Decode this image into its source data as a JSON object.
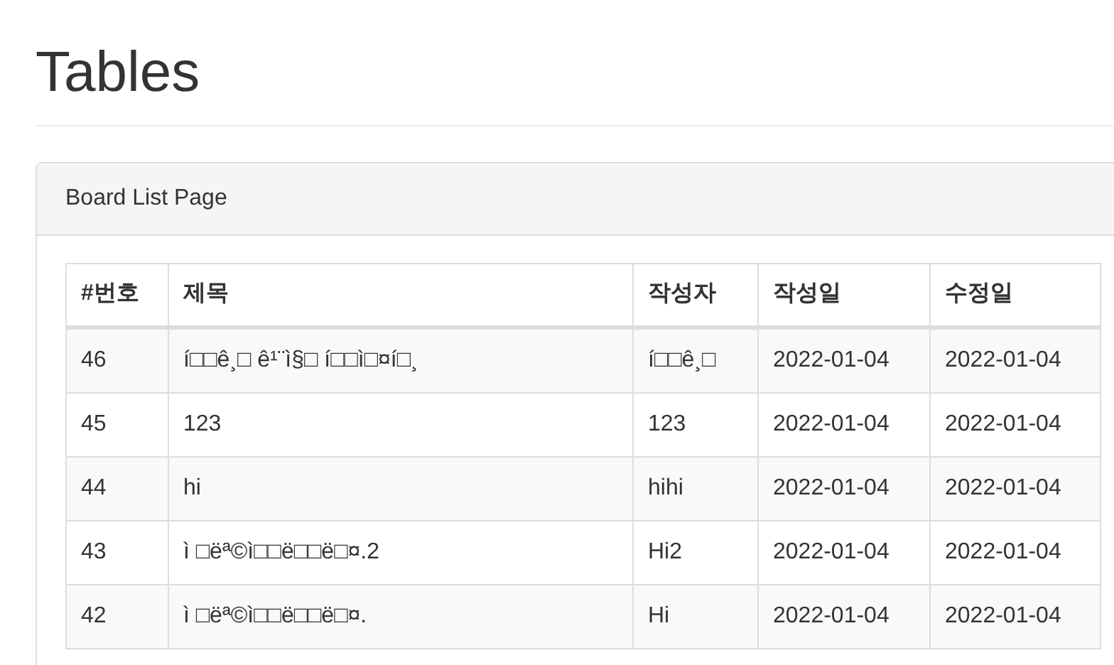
{
  "page_title": "Tables",
  "panel": {
    "heading": "Board List Page"
  },
  "table": {
    "columns": [
      "#번호",
      "제목",
      "작성자",
      "작성일",
      "수정일"
    ],
    "rows": [
      [
        "46",
        "í□□ê¸□ ê¹¨ì§□ í□□ì□¤í□¸",
        "í□□ê¸□",
        "2022-01-04",
        "2022-01-04"
      ],
      [
        "45",
        "123",
        "123",
        "2022-01-04",
        "2022-01-04"
      ],
      [
        "44",
        "hi",
        "hihi",
        "2022-01-04",
        "2022-01-04"
      ],
      [
        "43",
        "ì □ëª©ì□□ë□□ë□¤.2",
        "Hi2",
        "2022-01-04",
        "2022-01-04"
      ],
      [
        "42",
        "ì □ëª©ì□□ë□□ë□¤.",
        "Hi",
        "2022-01-04",
        "2022-01-04"
      ]
    ]
  }
}
